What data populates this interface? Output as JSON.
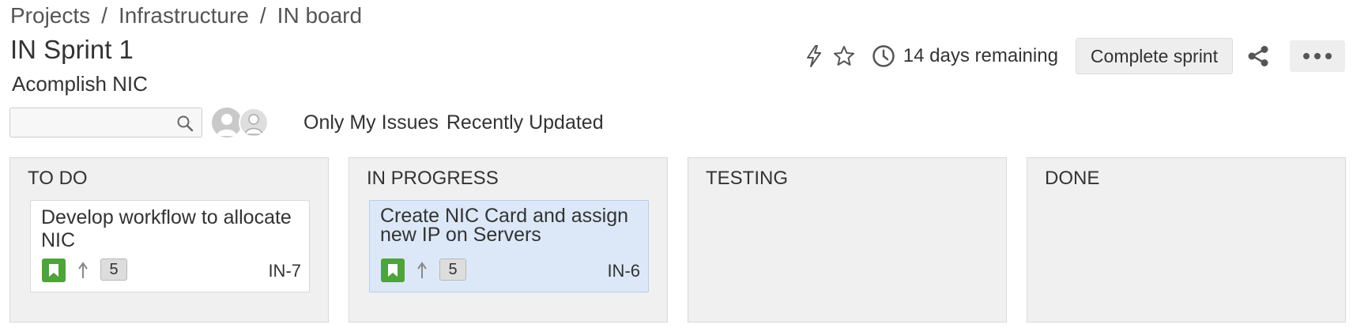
{
  "breadcrumb": {
    "items": [
      "Projects",
      "Infrastructure",
      "IN board"
    ],
    "separator": "/"
  },
  "sprint": {
    "title": "IN Sprint 1",
    "goal": "Acomplish NIC"
  },
  "header": {
    "remaining": "14 days remaining",
    "complete_label": "Complete sprint",
    "icons": [
      "lightning-icon",
      "star-icon",
      "clock-icon",
      "share-icon",
      "more-icon"
    ]
  },
  "filters": {
    "search_value": "",
    "search_placeholder": "",
    "quick_filters": [
      "Only My Issues",
      "Recently Updated"
    ]
  },
  "columns": [
    {
      "title": "TO DO",
      "cards": [
        {
          "summary": "Develop workflow to allocate NIC",
          "key": "IN-7",
          "estimate": "5",
          "type": "story",
          "priority": "major",
          "selected": false
        }
      ]
    },
    {
      "title": "IN PROGRESS",
      "cards": [
        {
          "summary": "Create NIC Card and assign new IP on Servers",
          "key": "IN-6",
          "estimate": "5",
          "type": "story",
          "priority": "major",
          "selected": true
        }
      ]
    },
    {
      "title": "TESTING",
      "cards": []
    },
    {
      "title": "DONE",
      "cards": []
    }
  ],
  "colors": {
    "story": "#4ea33b",
    "selected_card": "#dce8f8",
    "column_bg": "#f0f0f0"
  }
}
